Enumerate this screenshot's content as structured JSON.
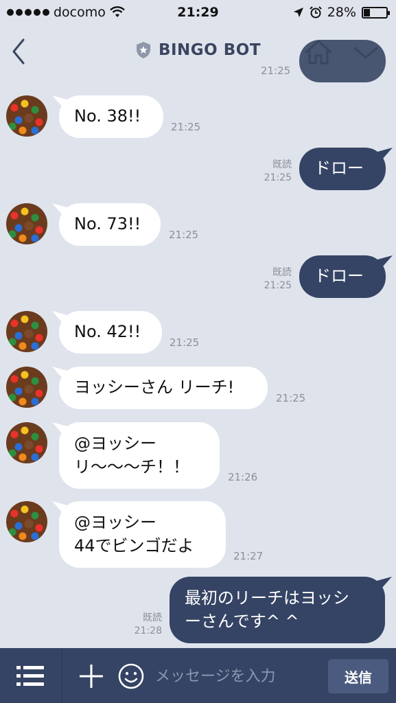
{
  "status_bar": {
    "carrier": "docomo",
    "time": "21:29",
    "battery": "28%",
    "battery_level": 0.28
  },
  "header": {
    "title": "BINGO BOT",
    "ghost_time": "21:25"
  },
  "messages": [
    {
      "side": "in",
      "lines": [
        "No. 38!!"
      ],
      "time": "21:25"
    },
    {
      "side": "out",
      "lines": [
        "ドロー"
      ],
      "read": "既読",
      "time": "21:25"
    },
    {
      "side": "in",
      "lines": [
        "No. 73!!"
      ],
      "time": "21:25"
    },
    {
      "side": "out",
      "lines": [
        "ドロー"
      ],
      "read": "既読",
      "time": "21:25"
    },
    {
      "side": "in",
      "lines": [
        "No. 42!!"
      ],
      "time": "21:25"
    },
    {
      "side": "in",
      "lines": [
        "ヨッシーさん リーチ!"
      ],
      "time": "21:25"
    },
    {
      "side": "in",
      "lines": [
        "@ヨッシー",
        "リ〜〜〜チ！！"
      ],
      "time": "21:26"
    },
    {
      "side": "in",
      "lines": [
        "@ヨッシー",
        "44でビンゴだよ"
      ],
      "time": "21:27"
    },
    {
      "side": "out",
      "lines": [
        "最初のリーチはヨッシ",
        "ーさんです^ ^"
      ],
      "read": "既読",
      "time": "21:28"
    }
  ],
  "composer": {
    "placeholder": "メッセージを入力",
    "send_label": "送信"
  },
  "colors": {
    "background": "#dfe3ec",
    "outgoing_bubble": "#354464",
    "incoming_bubble": "#ffffff",
    "bottom_bar": "#354464"
  }
}
